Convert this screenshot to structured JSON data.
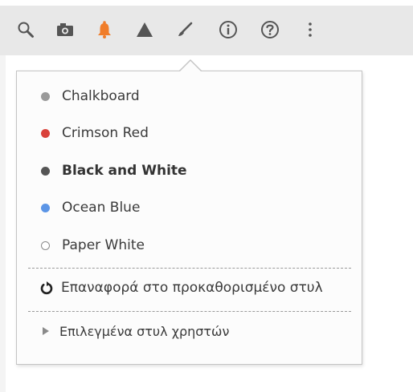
{
  "toolbar": {
    "icons": [
      "search-icon",
      "camera-icon",
      "bell-icon",
      "triangle-icon",
      "brush-icon",
      "info-icon",
      "help-icon",
      "more-vertical-icon"
    ],
    "bell_color": "#f07d2a",
    "icon_color": "#555555"
  },
  "theme_menu": {
    "styles": [
      {
        "label": "Chalkboard",
        "dot_color": "#9a9a9a",
        "selected": false
      },
      {
        "label": "Crimson Red",
        "dot_color": "#d9413a",
        "selected": false
      },
      {
        "label": "Black and White",
        "dot_color": "#555555",
        "selected": true
      },
      {
        "label": "Ocean Blue",
        "dot_color": "#5b95e6",
        "selected": false
      },
      {
        "label": "Paper White",
        "dot_color": "#ffffff",
        "selected": false
      }
    ],
    "reset_label": "Επαναφορά στο προκαθορισμένο στυλ",
    "user_styles_label": "Επιλεγμένα στυλ χρηστών"
  }
}
